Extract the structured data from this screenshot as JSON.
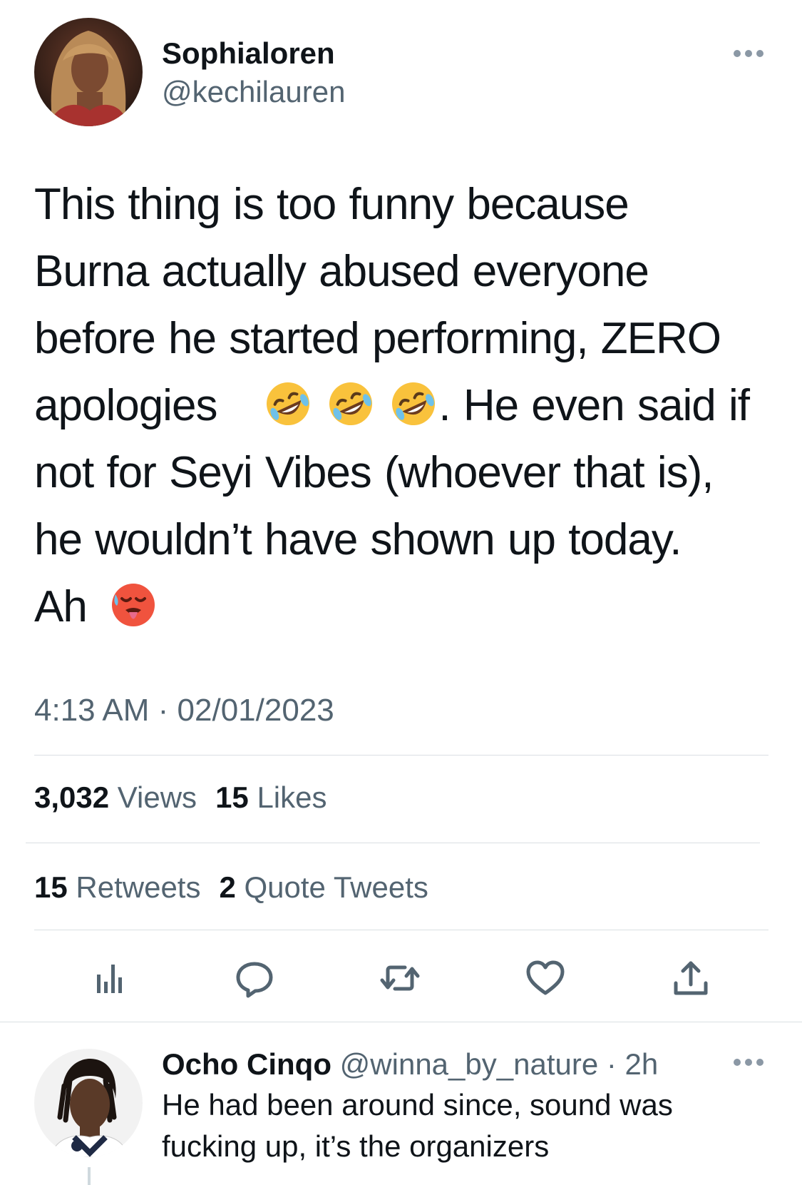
{
  "tweet": {
    "display_name": "Sophialoren",
    "handle": "@kechilauren",
    "lines": [
      "This thing is too funny because",
      "Burna actually abused everyone",
      "before he started performing, ZERO",
      "apologies",
      ". He even said if",
      "not for Seyi Vibes (whoever that is),",
      "he wouldn’t  have  shown  up today.",
      "Ah"
    ],
    "emojis": [
      "rofl-emoji",
      "rofl-emoji",
      "rofl-emoji",
      "hot-face-emoji"
    ],
    "time": "4:13 AM",
    "date": "02/01/2023",
    "separator": " · ",
    "stats": {
      "views_count": "3,032",
      "views_label": "Views",
      "likes_count": "15",
      "likes_label": "Likes",
      "retweets_count": "15",
      "retweets_label": "Retweets",
      "quotes_count": "2",
      "quotes_label": "Quote Tweets"
    },
    "actions": [
      "analytics-icon",
      "reply-icon",
      "retweet-icon",
      "like-icon",
      "share-icon"
    ]
  },
  "reply": {
    "display_name": "Ocho Cinqo",
    "handle": "@winna_by_nature",
    "separator": " · ",
    "time": "2h",
    "lines": [
      "He had been around since, sound was",
      "fucking up, it’s the organizers"
    ]
  },
  "colors": {
    "text": "#0f1419",
    "secondary": "#536471",
    "divider": "#dadfe3",
    "emoji_face": "#f9c23c",
    "hot_face": "#f0533e"
  }
}
